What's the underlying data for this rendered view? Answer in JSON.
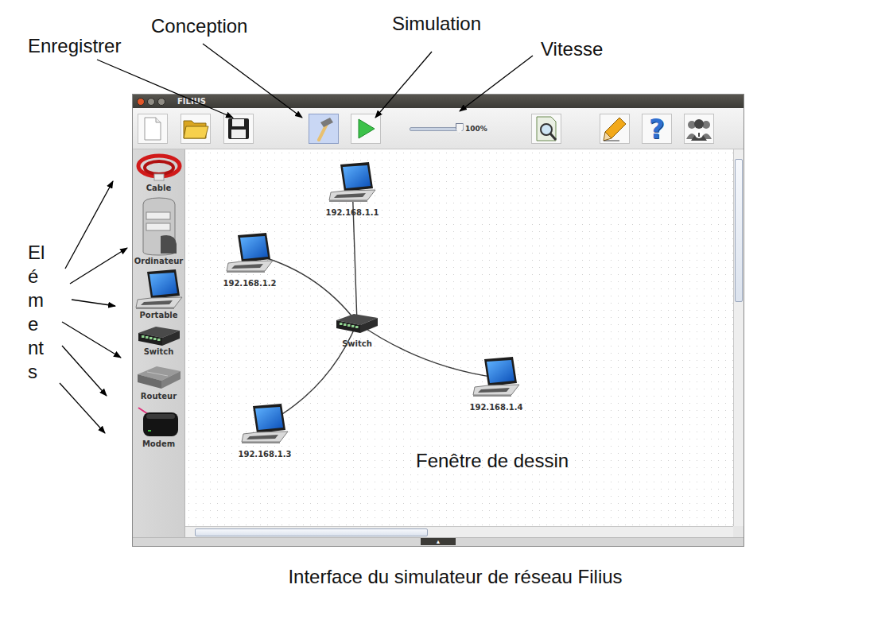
{
  "window": {
    "title": "FILIUS"
  },
  "toolbar": {
    "mode": {
      "design_selected": true,
      "simulation_selected": false
    },
    "speed": {
      "level": 0.92,
      "reading": "100%"
    },
    "help": {
      "glyph": "?"
    }
  },
  "palette": [
    {
      "kind": "cable",
      "label": "Cable"
    },
    {
      "kind": "computer",
      "label": "Ordinateur"
    },
    {
      "kind": "laptop",
      "label": "Portable"
    },
    {
      "kind": "switch",
      "label": "Switch"
    },
    {
      "kind": "router",
      "label": "Routeur"
    },
    {
      "kind": "modem",
      "label": "Modem"
    }
  ],
  "canvas": {
    "label": "Fenêtre de dessin",
    "nodes": [
      {
        "kind": "laptop",
        "label": "192.168.1.1",
        "connected_to": "Switch"
      },
      {
        "kind": "laptop",
        "label": "192.168.1.2",
        "connected_to": "Switch"
      },
      {
        "kind": "switch",
        "label": "Switch",
        "connected_to": ""
      },
      {
        "kind": "laptop",
        "label": "192.168.1.3",
        "connected_to": "Switch"
      },
      {
        "kind": "laptop",
        "label": "192.168.1.4",
        "connected_to": "Switch"
      }
    ],
    "scroll": {
      "horizontal_thumb": 0.44,
      "vertical_thumb": 0.4
    },
    "bottom_toggle": "▲"
  },
  "annotations": {
    "save": "Enregistrer",
    "design": "Conception",
    "simulation": "Simulation",
    "speed": "Vitesse",
    "elements": "Eléments"
  },
  "caption": "Interface du simulateur de réseau Filius"
}
